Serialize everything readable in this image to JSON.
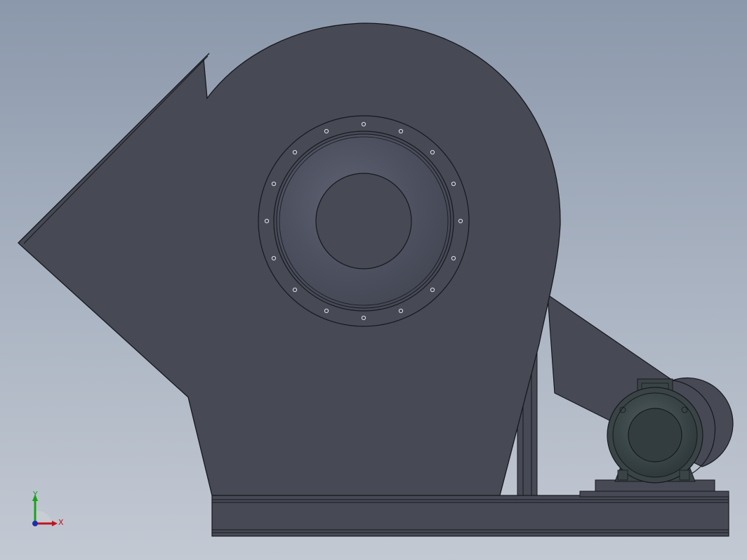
{
  "viewport": {
    "name": "cad-graphics-area",
    "background_top": "#8b98ab",
    "background_bottom": "#c3c9d3"
  },
  "model": {
    "description_icon": "centrifugal-fan-assembly",
    "body_color": "#474a55",
    "edge_color": "#16181d",
    "motor_color": "#3a4446"
  },
  "triad": {
    "x_label": "X",
    "y_label": "Y",
    "x_color": "#c0141c",
    "y_color": "#19a319",
    "z_color": "#1b2fb0"
  }
}
